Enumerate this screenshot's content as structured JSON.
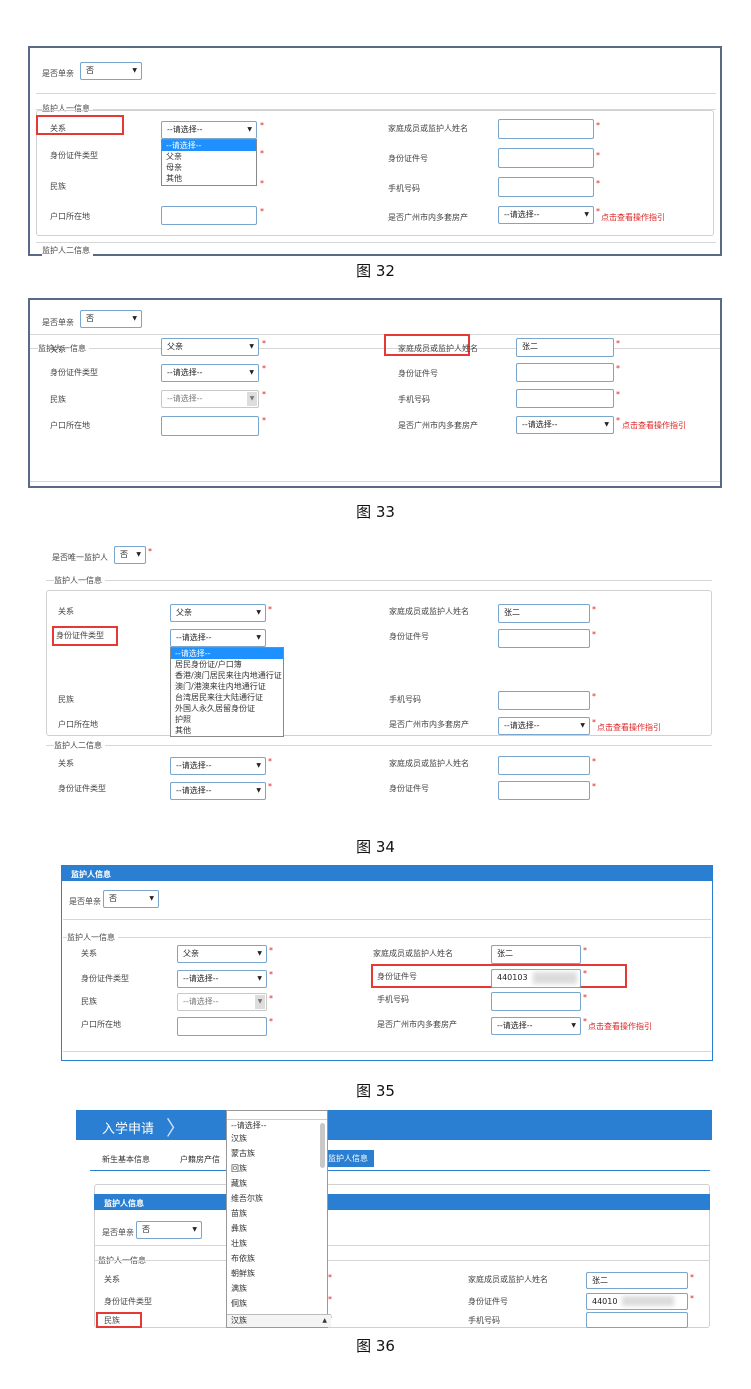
{
  "captions": [
    "图 32",
    "图 33",
    "图 34",
    "图 35",
    "图 36"
  ],
  "labels": {
    "single": "是否单亲",
    "single_only": "是否唯一监护人",
    "guardian1": "监护人一信息",
    "guardian2": "监护人二信息",
    "guardian_info": "监护人信息",
    "relation": "关系",
    "id_type": "身份证件类型",
    "ethnicity": "民族",
    "hukou": "户口所在地",
    "member_name": "家庭成员或监护人姓名",
    "id_number": "身份证件号",
    "phone": "手机号码",
    "gz_property": "是否广州市内多套房产",
    "guide_link": "点击查看操作指引"
  },
  "values": {
    "single_value": "否",
    "please_select": "--请选择--",
    "father": "父亲",
    "name": "张二",
    "id_partial_35": "440103",
    "id_partial_36": "44010"
  },
  "relation_options": [
    "--请选择--",
    "父亲",
    "母亲",
    "其他"
  ],
  "id_type_options": [
    "--请选择--",
    "居民身份证/户口簿",
    "香港/澳门居民来往内地通行证",
    "澳门/港澳来往内地通行证",
    "台湾居民来往大陆通行证",
    "外国人永久居留身份证",
    "护照",
    "其他"
  ],
  "ethnicity_options": [
    "--请选择--",
    "汉族",
    "蒙古族",
    "回族",
    "藏族",
    "维吾尔族",
    "苗族",
    "彝族",
    "壮族",
    "布依族",
    "朝鲜族",
    "满族",
    "侗族"
  ],
  "ethnicity_selected": "汉族",
  "app": {
    "title": "入学申请",
    "tab_basic": "新生基本信息",
    "tab_hukou": "户籍房产信",
    "tab_guardian": "监护人信息"
  },
  "colors": {
    "accent": "#2a7fd2",
    "highlight": "#e53935",
    "required": "#e02020"
  }
}
